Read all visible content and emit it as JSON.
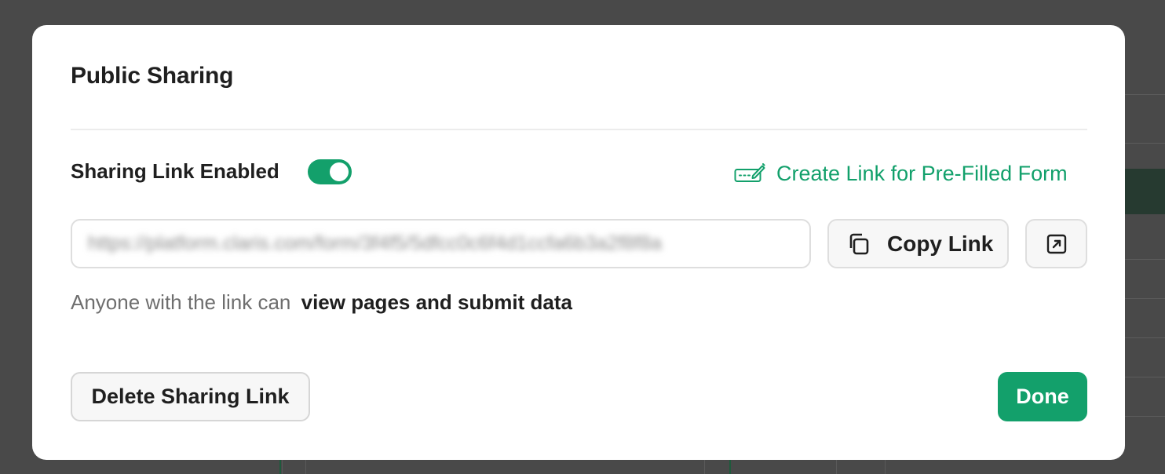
{
  "modal": {
    "title": "Public Sharing",
    "sharing_enabled_label": "Sharing Link Enabled",
    "sharing_enabled": true,
    "prefill_link_label": "Create Link for Pre-Filled Form",
    "share_url": "https://platform.claris.com/form/3f4f5/5dfcc0c6f4d1ccfa6b3a2f8f8a",
    "copy_label": "Copy Link",
    "permission_prefix": "Anyone with the link can",
    "permission_value": "view pages and submit data",
    "delete_label": "Delete Sharing Link",
    "done_label": "Done"
  },
  "colors": {
    "accent": "#13a06b",
    "overlay": "#4a4a4a"
  },
  "icons": {
    "prefill": "form-pen-icon",
    "copy": "copy-icon",
    "open": "open-external-icon"
  }
}
